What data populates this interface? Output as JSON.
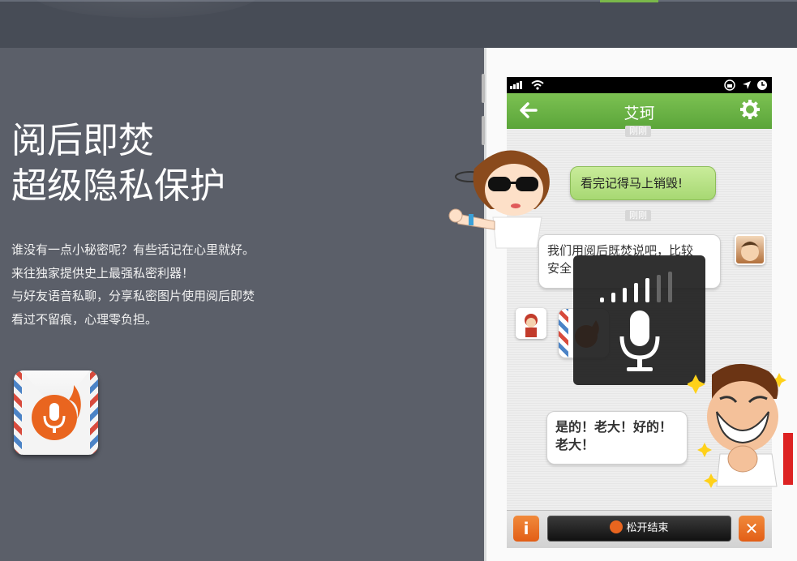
{
  "hero": {
    "headline_line1": "阅后即焚",
    "headline_line2": "超级隐私保护",
    "desc_lines": [
      "谁没有一点小秘密呢？有些话记在心里就好。",
      "来往独家提供史上最强私密利器！",
      "与好友语音私聊，分享私密图片使用阅后即焚",
      "看过不留痕，心理零负担。"
    ]
  },
  "phone": {
    "chat_title": "艾珂",
    "timestamps": [
      "刚刚",
      "刚刚"
    ],
    "messages": [
      {
        "side": "right",
        "text": "看完记得马上销毁!"
      },
      {
        "side": "left",
        "text_line1": "我们用阅后既焚说吧，比较",
        "text_line2": "安全"
      },
      {
        "side": "left",
        "text_line1": "是的！老大！好的！",
        "text_line2": "老大！"
      }
    ],
    "release_button": "松开结束",
    "info_button": "i",
    "cancel_button": "✕"
  },
  "colors": {
    "accent_green": "#5ba53a",
    "orange": "#e9651f",
    "page_bg": "#5b5f69"
  }
}
